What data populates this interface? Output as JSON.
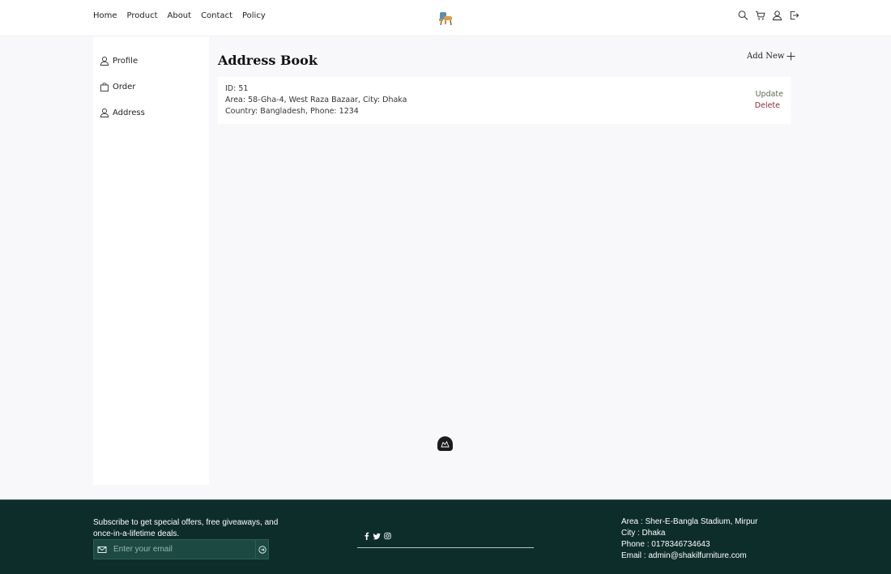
{
  "header": {
    "nav": [
      "Home",
      "Product",
      "About",
      "Contact",
      "Policy"
    ],
    "icons": [
      "search-icon",
      "cart-icon",
      "user-icon",
      "logout-icon"
    ],
    "logo": "chair-logo"
  },
  "sidebar": {
    "items": [
      {
        "label": "Profile",
        "icon": "user-icon"
      },
      {
        "label": "Order",
        "icon": "bag-icon"
      },
      {
        "label": "Address",
        "icon": "user-icon"
      }
    ]
  },
  "main": {
    "title": "Address Book",
    "add_new_label": "Add New",
    "address": {
      "id_line": "ID: 51",
      "area_line": "Area: 58-Gha-4, West Raza Bazaar, City: Dhaka",
      "country_line": "Country: Bangladesh, Phone: 1234",
      "update_label": "Update",
      "delete_label": "Delete"
    }
  },
  "footer": {
    "subscribe_line1": "Subscribe to get special offers, free giveaways, and",
    "subscribe_line2": "once-in-a-lifetime deals.",
    "email_placeholder": "Enter your email",
    "social": [
      "facebook-icon",
      "twitter-icon",
      "instagram-icon"
    ],
    "contact": {
      "area": "Area : Sher-E-Bangla Stadium, Mirpur",
      "city": "City : Dhaka",
      "phone": "Phone : 01783467346​43",
      "email": "Email : admin@shakilfurniture.com"
    }
  },
  "colors": {
    "footer_bg": "#0d2d2a",
    "update": "#5a6b4a",
    "delete": "#8b2c3a",
    "page_bg": "#f8f8fa"
  }
}
